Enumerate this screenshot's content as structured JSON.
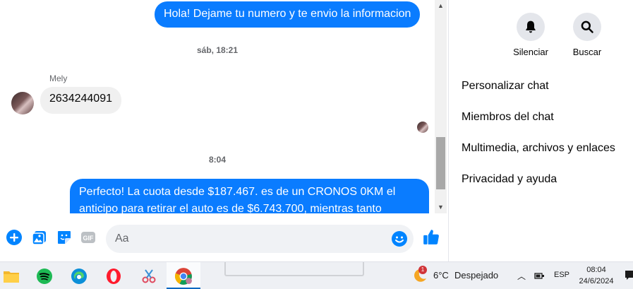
{
  "chat": {
    "messages": [
      {
        "type": "outgoing",
        "text": "Hola! Dejame tu numero y te envio la informacion"
      },
      {
        "type": "timestamp",
        "text": "sáb, 18:21"
      },
      {
        "type": "sender",
        "text": "Mely"
      },
      {
        "type": "incoming",
        "text": "2634244091"
      },
      {
        "type": "timestamp",
        "text": "8:04"
      },
      {
        "type": "outgoing",
        "line1": "Perfecto! La cuota desde $187.467. es de un CRONOS 0KM el",
        "line2": "anticipo para retirar el auto es de $6.743.700, mientras tanto"
      }
    ],
    "composer": {
      "placeholder": "Aa"
    }
  },
  "side": {
    "actions": [
      {
        "label": "Silenciar",
        "icon": "bell-icon"
      },
      {
        "label": "Buscar",
        "icon": "search-icon"
      }
    ],
    "items": [
      {
        "label": "Personalizar chat"
      },
      {
        "label": "Miembros del chat"
      },
      {
        "label": "Multimedia, archivos y enlaces"
      },
      {
        "label": "Privacidad y ayuda"
      }
    ]
  },
  "taskbar": {
    "apps": [
      "file-explorer-icon",
      "spotify-icon",
      "edge-icon",
      "opera-icon",
      "snipping-tool-icon",
      "chrome-icon"
    ],
    "weather": {
      "temp": "6°C",
      "condition": "Despejado",
      "badge": "1"
    },
    "lang": "ESP",
    "time": "08:04",
    "date": "24/6/2024"
  },
  "colors": {
    "accent": "#0a7cff",
    "messenger_blue": "#0084ff"
  }
}
